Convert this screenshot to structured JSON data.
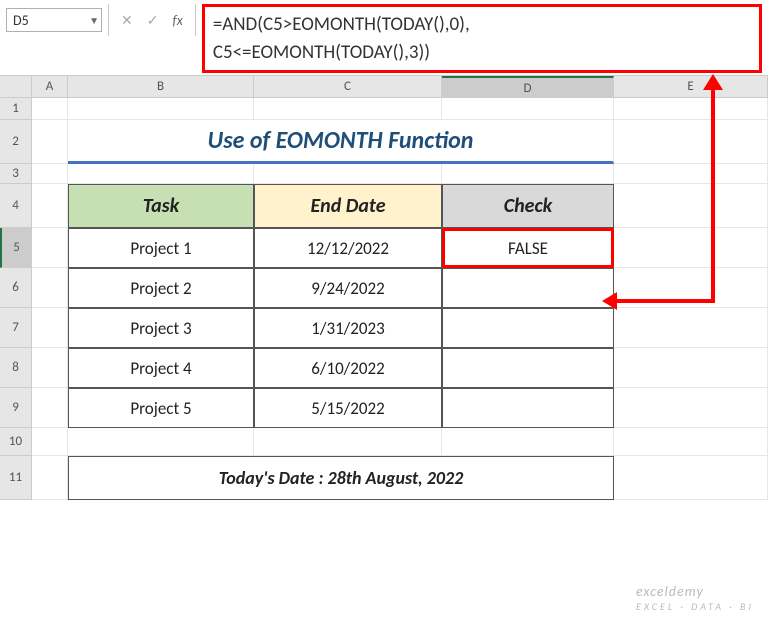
{
  "nameBox": "D5",
  "formula": {
    "line1": "=AND(C5>EOMONTH(TODAY(),0),",
    "line2": "C5<=EOMONTH(TODAY(),3))"
  },
  "columns": [
    "A",
    "B",
    "C",
    "D",
    "E"
  ],
  "title": "Use of EOMONTH Function",
  "headers": {
    "task": "Task",
    "endDate": "End Date",
    "check": "Check"
  },
  "rows": [
    {
      "task": "Project 1",
      "endDate": "12/12/2022",
      "check": "FALSE"
    },
    {
      "task": "Project 2",
      "endDate": "9/24/2022",
      "check": ""
    },
    {
      "task": "Project 3",
      "endDate": "1/31/2023",
      "check": ""
    },
    {
      "task": "Project 4",
      "endDate": "6/10/2022",
      "check": ""
    },
    {
      "task": "Project 5",
      "endDate": "5/15/2022",
      "check": ""
    }
  ],
  "footer": "Today's Date : 28th August, 2022",
  "watermark": {
    "brand": "exceldemy",
    "tag": "EXCEL · DATA · BI"
  },
  "fx": {
    "cancel": "✕",
    "enter": "✓",
    "fx": "fx"
  }
}
